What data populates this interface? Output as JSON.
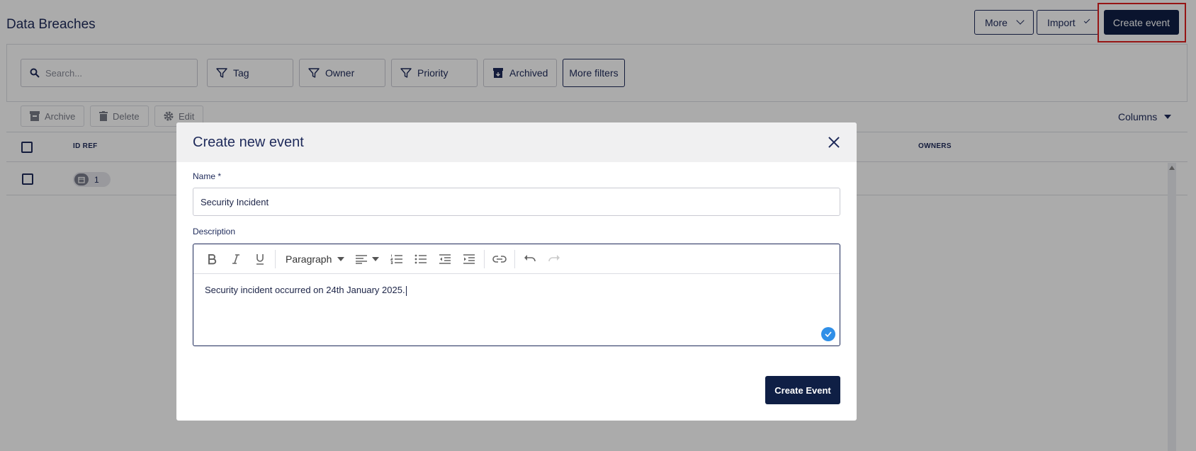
{
  "page": {
    "title": "Data Breaches"
  },
  "header": {
    "more_label": "More",
    "import_label": "Import",
    "create_label": "Create event"
  },
  "filters": {
    "search_placeholder": "Search...",
    "tag_label": "Tag",
    "owner_label": "Owner",
    "priority_label": "Priority",
    "archived_label": "Archived",
    "more_filters_label": "More filters"
  },
  "actions": {
    "archive_label": "Archive",
    "delete_label": "Delete",
    "edit_label": "Edit",
    "columns_label": "Columns"
  },
  "table": {
    "columns": [
      "ID REF",
      "OWNERS"
    ],
    "rows": [
      {
        "id_ref": "1"
      }
    ]
  },
  "modal": {
    "title": "Create new event",
    "name_label": "Name *",
    "name_value": "Security Incident",
    "description_label": "Description",
    "paragraph_label": "Paragraph",
    "description_value": "Security incident occurred on 24th January 2025.",
    "submit_label": "Create Event"
  },
  "colors": {
    "primary": "#0f1f45",
    "text": "#1e2a5a",
    "highlight": "#e02020",
    "check": "#2f8fe8"
  }
}
